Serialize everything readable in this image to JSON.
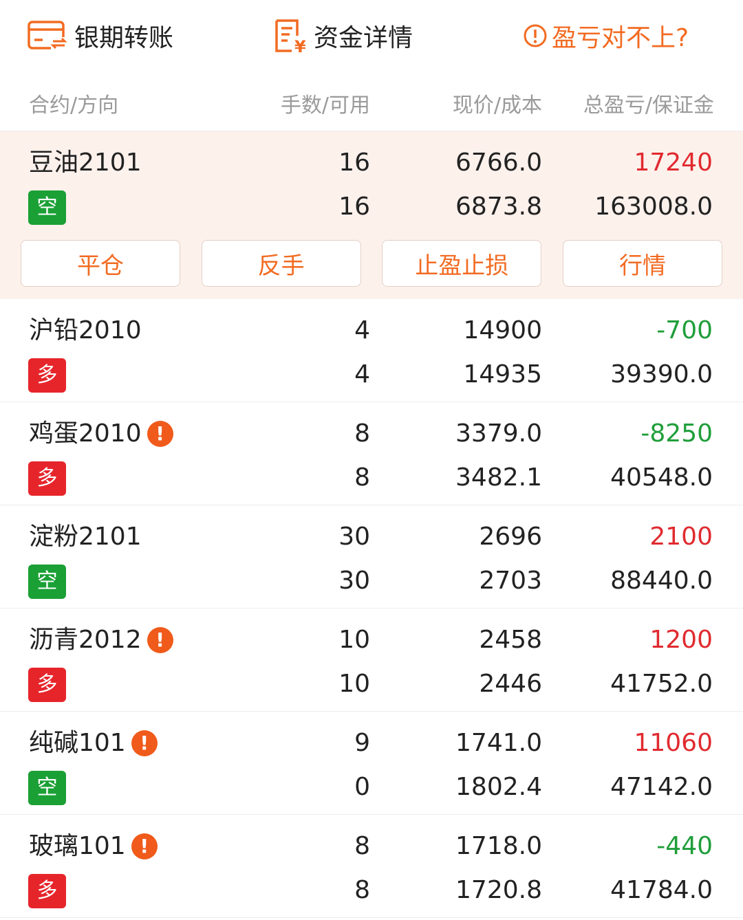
{
  "toolbar": {
    "bank_transfer": "银期转账",
    "fund_detail": "资金详情",
    "pnl_mismatch": "盈亏对不上?"
  },
  "columns": {
    "contract": "合约/方向",
    "lots": "手数/可用",
    "price": "现价/成本",
    "pnl": "总盈亏/保证金"
  },
  "actions": {
    "close": "平仓",
    "reverse": "反手",
    "tp_sl": "止盈止损",
    "quote": "行情"
  },
  "colors": {
    "accent": "#f26b22",
    "profit": "#e02a2f",
    "loss": "#1f9e3a",
    "short_badge": "#1aa035",
    "long_badge": "#e6252b",
    "selected_bg": "#fdf1ec"
  },
  "positions": [
    {
      "name": "豆油2101",
      "warning": false,
      "direction": "空",
      "lots": "16",
      "available": "16",
      "price": "6766.0",
      "cost": "6873.8",
      "pnl": "17240",
      "margin": "163008.0"
    },
    {
      "name": "沪铅2010",
      "warning": false,
      "direction": "多",
      "lots": "4",
      "available": "4",
      "price": "14900",
      "cost": "14935",
      "pnl": "-700",
      "margin": "39390.0"
    },
    {
      "name": "鸡蛋2010",
      "warning": true,
      "warning_icon": "!",
      "direction": "多",
      "lots": "8",
      "available": "8",
      "price": "3379.0",
      "cost": "3482.1",
      "pnl": "-8250",
      "margin": "40548.0"
    },
    {
      "name": "淀粉2101",
      "warning": false,
      "direction": "空",
      "lots": "30",
      "available": "30",
      "price": "2696",
      "cost": "2703",
      "pnl": "2100",
      "margin": "88440.0"
    },
    {
      "name": "沥青2012",
      "warning": true,
      "warning_icon": "!",
      "direction": "多",
      "lots": "10",
      "available": "10",
      "price": "2458",
      "cost": "2446",
      "pnl": "1200",
      "margin": "41752.0"
    },
    {
      "name": "纯碱101",
      "warning": true,
      "warning_icon": "!",
      "direction": "空",
      "lots": "9",
      "available": "0",
      "price": "1741.0",
      "cost": "1802.4",
      "pnl": "11060",
      "margin": "47142.0"
    },
    {
      "name": "玻璃101",
      "warning": true,
      "warning_icon": "!",
      "direction": "多",
      "lots": "8",
      "available": "8",
      "price": "1718.0",
      "cost": "1720.8",
      "pnl": "-440",
      "margin": "41784.0"
    }
  ]
}
